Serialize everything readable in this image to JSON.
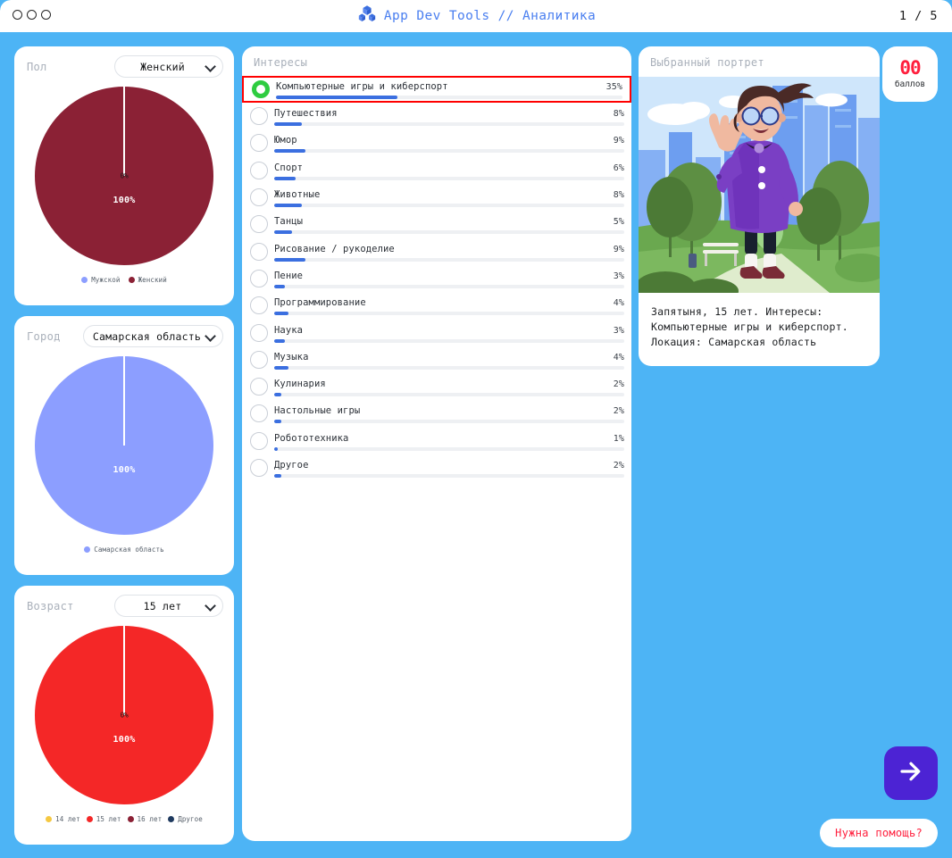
{
  "window": {
    "traffic_lights": [
      "close",
      "minimize",
      "maximize"
    ],
    "brand": "App Dev Tools // Аналитика",
    "logo_icon": "cubes-logo-icon",
    "page_indicator": "1 / 5"
  },
  "score_badge": {
    "value": "00",
    "unit": "баллов",
    "color": "#ff1f3d"
  },
  "left_panel": {
    "gender": {
      "label": "Пол",
      "select_value": "Женский",
      "chart_data": {
        "type": "pie",
        "title": "Пол",
        "categories": [
          "Мужской",
          "Женский"
        ],
        "values": [
          0,
          100
        ],
        "value_labels": [
          "0%",
          "100%"
        ],
        "colors": [
          "#8c9eff",
          "#8b2135"
        ],
        "legend": [
          "Мужской",
          "Женский"
        ],
        "legend_position": "bottom"
      }
    },
    "city": {
      "label": "Город",
      "select_value": "Самарская область",
      "chart_data": {
        "type": "pie",
        "title": "Город",
        "categories": [
          "Самарская область"
        ],
        "values": [
          100
        ],
        "value_labels": [
          "100%"
        ],
        "colors": [
          "#8c9eff"
        ],
        "legend": [
          "Самарская область"
        ],
        "legend_position": "bottom"
      }
    },
    "age": {
      "label": "Возраст",
      "select_value": "15 лет",
      "chart_data": {
        "type": "pie",
        "title": "Возраст",
        "categories": [
          "14 лет",
          "15 лет",
          "16 лет",
          "Другое"
        ],
        "values": [
          0,
          100,
          0,
          0
        ],
        "value_labels": [
          "0%",
          "100%"
        ],
        "colors": [
          "#f5c842",
          "#f42727",
          "#8b2135",
          "#1f3a5f"
        ],
        "legend": [
          "14 лет",
          "15 лет",
          "16 лет",
          "Другое"
        ],
        "legend_position": "bottom"
      }
    }
  },
  "interests_panel": {
    "title": "Интересы",
    "selected_index": 0,
    "highlight_color": "#ff0000",
    "bar_color": "#3b6fe0",
    "radio_selected_color": "#2ecc40",
    "chart_data": {
      "type": "bar",
      "title": "Интересы",
      "orientation": "horizontal",
      "xlabel": "",
      "ylabel": "",
      "ylim": [
        0,
        100
      ],
      "categories": [
        "Компьютерные игры и киберспорт",
        "Путешествия",
        "Юмор",
        "Спорт",
        "Животные",
        "Танцы",
        "Рисование / рукоделие",
        "Пение",
        "Программирование",
        "Наука",
        "Музыка",
        "Кулинария",
        "Настольные игры",
        "Робототехника",
        "Другое"
      ],
      "values": [
        35,
        8,
        9,
        6,
        8,
        5,
        9,
        3,
        4,
        3,
        4,
        2,
        2,
        1,
        2
      ]
    },
    "items": [
      {
        "name": "Компьютерные игры и киберспорт",
        "pct": "35%",
        "value": 35,
        "selected": true
      },
      {
        "name": "Путешествия",
        "pct": "8%",
        "value": 8,
        "selected": false
      },
      {
        "name": "Юмор",
        "pct": "9%",
        "value": 9,
        "selected": false
      },
      {
        "name": "Спорт",
        "pct": "6%",
        "value": 6,
        "selected": false
      },
      {
        "name": "Животные",
        "pct": "8%",
        "value": 8,
        "selected": false
      },
      {
        "name": "Танцы",
        "pct": "5%",
        "value": 5,
        "selected": false
      },
      {
        "name": "Рисование / рукоделие",
        "pct": "9%",
        "value": 9,
        "selected": false
      },
      {
        "name": "Пение",
        "pct": "3%",
        "value": 3,
        "selected": false
      },
      {
        "name": "Программирование",
        "pct": "4%",
        "value": 4,
        "selected": false
      },
      {
        "name": "Наука",
        "pct": "3%",
        "value": 3,
        "selected": false
      },
      {
        "name": "Музыка",
        "pct": "4%",
        "value": 4,
        "selected": false
      },
      {
        "name": "Кулинария",
        "pct": "2%",
        "value": 2,
        "selected": false
      },
      {
        "name": "Настольные игры",
        "pct": "2%",
        "value": 2,
        "selected": false
      },
      {
        "name": "Робототехника",
        "pct": "1%",
        "value": 1,
        "selected": false
      },
      {
        "name": "Другое",
        "pct": "2%",
        "value": 2,
        "selected": false
      }
    ]
  },
  "portrait_panel": {
    "title": "Выбранный портрет",
    "illustration": "girl-waving-in-city-park-illustration",
    "description": "Запятыня, 15 лет. Интересы: Компьютерные игры и киберспорт. Локация: Самарская область"
  },
  "actions": {
    "next_icon": "arrow-right-icon",
    "next_color": "#4c23d4",
    "help_label": "Нужна помощь?",
    "help_color": "#ff1f3d"
  }
}
